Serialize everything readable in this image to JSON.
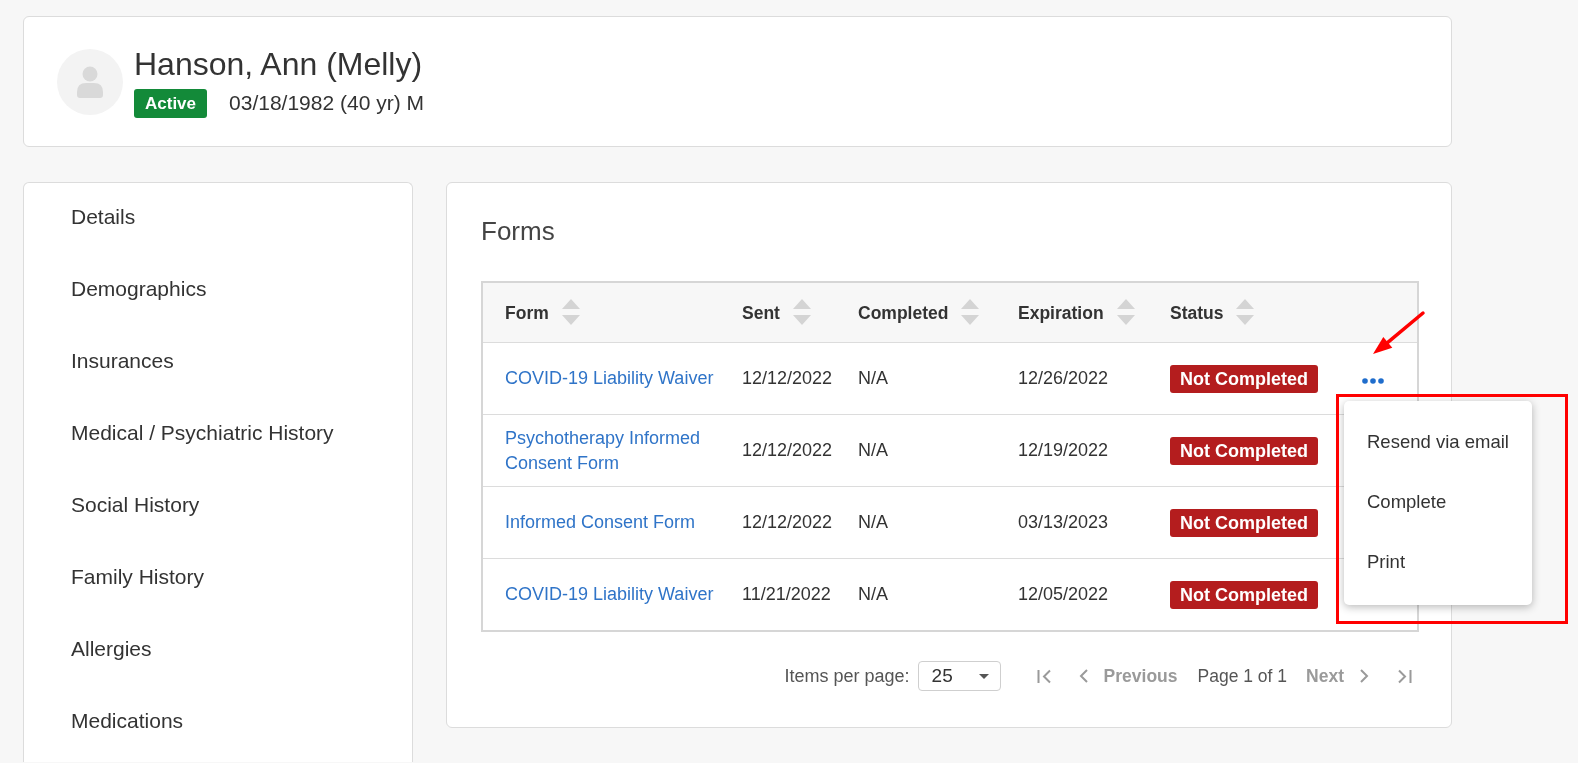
{
  "patient": {
    "name": "Hanson, Ann (Melly)",
    "status": "Active",
    "details": "03/18/1982 (40 yr) M"
  },
  "sidebar": {
    "items": [
      {
        "label": "Details",
        "selected": false
      },
      {
        "label": "Demographics",
        "selected": false
      },
      {
        "label": "Insurances",
        "selected": false
      },
      {
        "label": "Medical / Psychiatric History",
        "selected": false
      },
      {
        "label": "Social History",
        "selected": false
      },
      {
        "label": "Family History",
        "selected": false
      },
      {
        "label": "Allergies",
        "selected": false
      },
      {
        "label": "Medications",
        "selected": false
      }
    ]
  },
  "forms": {
    "title": "Forms",
    "columns": [
      "Form",
      "Sent",
      "Completed",
      "Expiration",
      "Status"
    ],
    "rows": [
      {
        "form": "COVID-19 Liability Waiver",
        "sent": "12/12/2022",
        "completed": "N/A",
        "expiration": "12/26/2022",
        "status": "Not Completed",
        "show_actions": true,
        "menu": {
          "items": [
            "Resend via email",
            "Complete",
            "Print"
          ]
        }
      },
      {
        "form": "Psychotherapy Informed Consent Form",
        "sent": "12/12/2022",
        "completed": "N/A",
        "expiration": "12/19/2022",
        "status": "Not Completed",
        "show_actions": false
      },
      {
        "form": "Informed Consent Form",
        "sent": "12/12/2022",
        "completed": "N/A",
        "expiration": "03/13/2023",
        "status": "Not Completed",
        "show_actions": false
      },
      {
        "form": "COVID-19 Liability Waiver",
        "sent": "11/21/2022",
        "completed": "N/A",
        "expiration": "12/05/2022",
        "status": "Not Completed",
        "show_actions": false
      }
    ],
    "pagination": {
      "items_per_page_label": "Items per page:",
      "page_size": "25",
      "first": {
        "disabled": true
      },
      "previous": {
        "label": "Previous",
        "disabled": true
      },
      "page_info": "Page 1 of 1",
      "next": {
        "label": "Next",
        "disabled": true
      },
      "last": {
        "disabled": true
      }
    }
  },
  "markup": {
    "arrow": true,
    "frame": true
  }
}
